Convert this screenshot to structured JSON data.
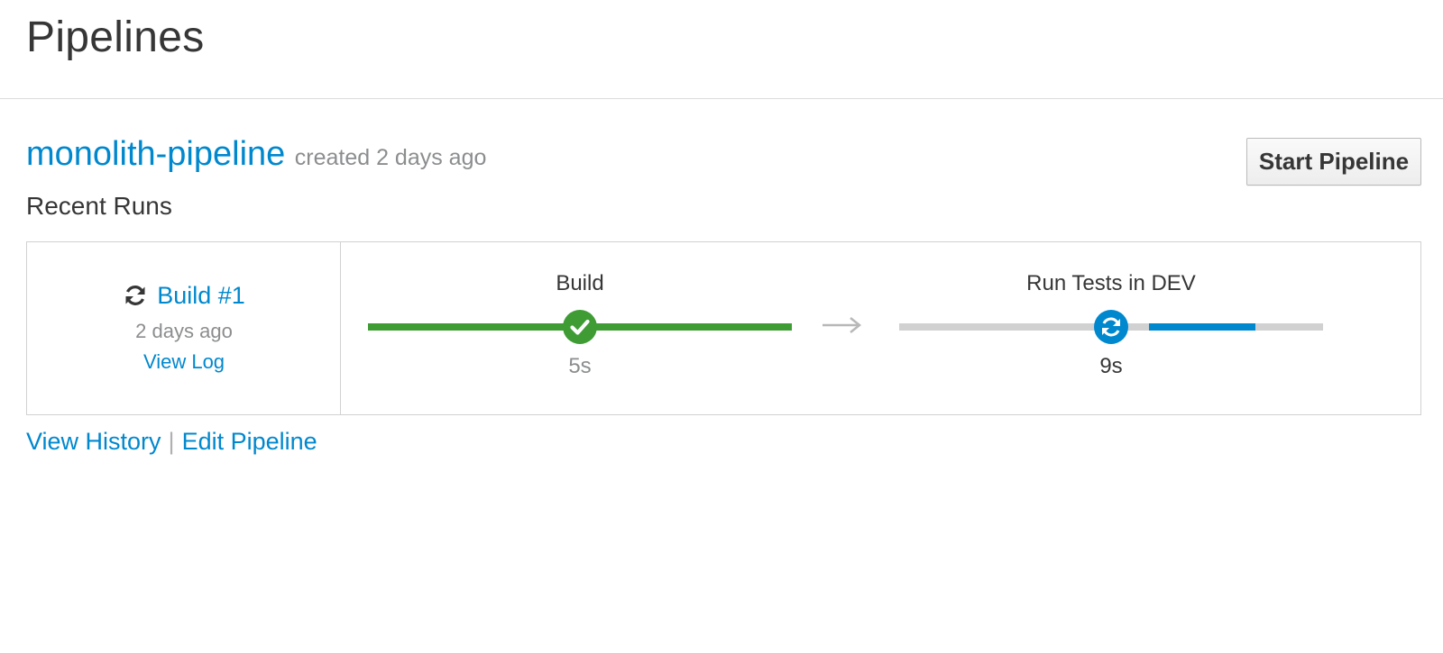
{
  "page": {
    "title": "Pipelines"
  },
  "pipeline": {
    "name": "monolith-pipeline",
    "created": "created 2 days ago",
    "start_button": "Start Pipeline",
    "recent_runs_label": "Recent Runs"
  },
  "run": {
    "build_label": "Build #1",
    "time": "2 days ago",
    "view_log": "View Log",
    "status_icon": "refresh-icon"
  },
  "stages": [
    {
      "name": "Build",
      "duration": "5s",
      "status": "complete",
      "icon": "check-icon",
      "progress": 1.0,
      "color": "#3f9c35"
    },
    {
      "name": "Run Tests in DEV",
      "duration": "9s",
      "status": "running",
      "icon": "refresh-icon",
      "progress": 0.25,
      "color": "#0088ce"
    }
  ],
  "footer": {
    "view_history": "View History",
    "separator": "|",
    "edit_pipeline": "Edit Pipeline"
  },
  "colors": {
    "link": "#0088ce",
    "success": "#3f9c35",
    "running": "#0088ce",
    "track": "#d1d1d1",
    "muted": "#8b8d8f"
  }
}
